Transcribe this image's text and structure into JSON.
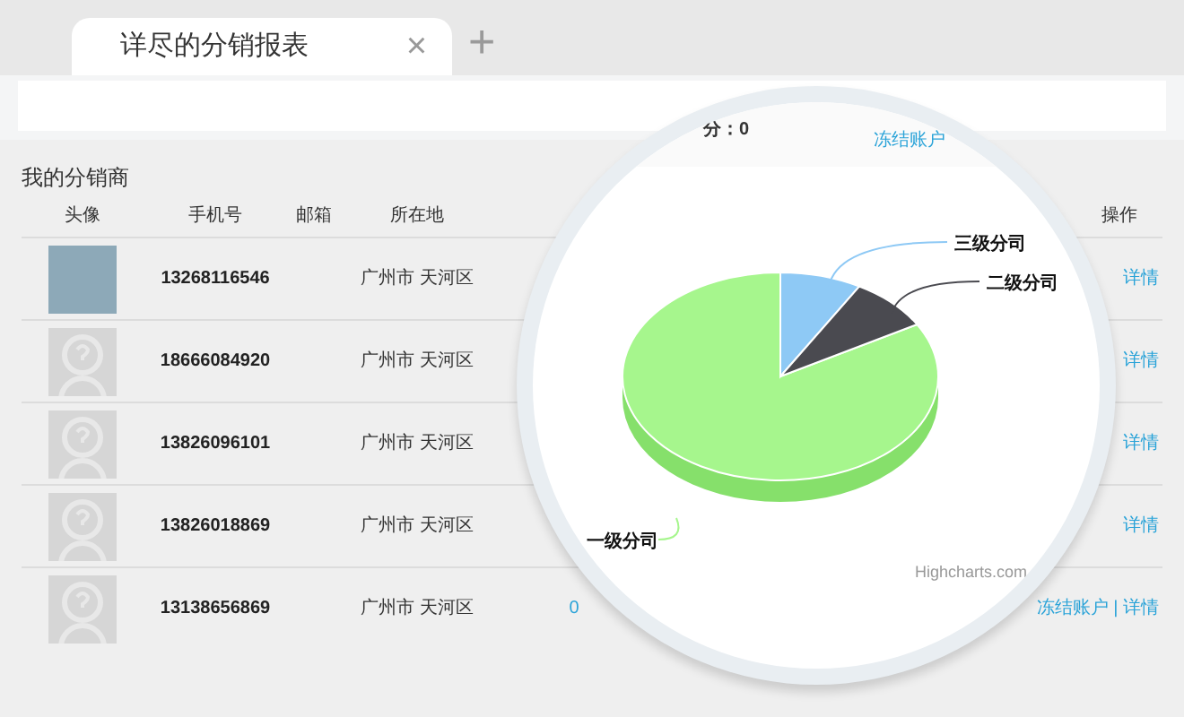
{
  "tab": {
    "title": "详尽的分销报表",
    "close": "×",
    "selected": true
  },
  "new_tab": "+",
  "top_bar": {
    "points": "分：0",
    "freeze_link": "冻结账户"
  },
  "section_title": "我的分销商",
  "table": {
    "columns": [
      "头像",
      "手机号",
      "邮箱",
      "所在地",
      "操作"
    ],
    "rows": [
      {
        "avatar": {
          "kind": "photo"
        },
        "phone": "13268116546",
        "location": "广州市 天河区",
        "column_5": "",
        "action": "详情"
      },
      {
        "avatar": {
          "kind": "placeholder"
        },
        "phone": "18666084920",
        "location": "广州市 天河区",
        "column_5": "",
        "action": "详情"
      },
      {
        "avatar": {
          "kind": "placeholder"
        },
        "phone": "13826096101",
        "location": "广州市 天河区",
        "column_5": "",
        "action": "详情"
      },
      {
        "avatar": {
          "kind": "placeholder"
        },
        "phone": "13826018869",
        "location": "广州市 天河区",
        "column_5": "",
        "action": "详情"
      },
      {
        "avatar": {
          "kind": "placeholder"
        },
        "phone": "13138656869",
        "location": "广州市 天河区",
        "column_5": "0",
        "action": "冻结账户 | 详情"
      }
    ]
  },
  "chart": {
    "slices": [
      {
        "label": "一级分司",
        "color": "#a6f68d"
      },
      {
        "label": "三级分司",
        "color": "#8ec9f5"
      },
      {
        "label": "二级分司",
        "color": "#4a4a50"
      }
    ],
    "credit": "Highcharts.com"
  }
}
